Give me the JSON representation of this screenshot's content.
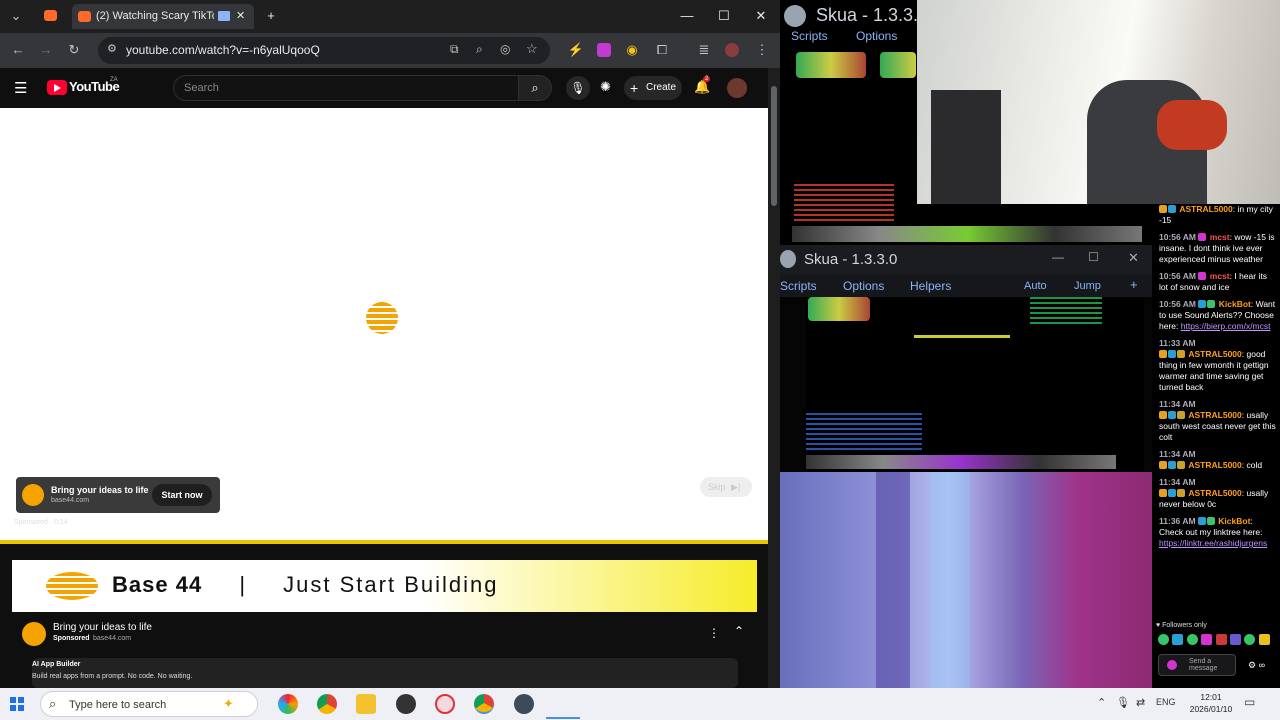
{
  "chrome": {
    "tab_title": "(2) Watching Scary TikToks",
    "url": "youtube.com/watch?v=-n6yalUqooQ",
    "new_tab": "+",
    "win_minimize": "—",
    "win_maximize": "☐",
    "win_close": "✕"
  },
  "youtube": {
    "logo": "YouTube",
    "country": "ZA",
    "search_placeholder": "Search",
    "create_label": "Create",
    "notification_count": "2",
    "ad_title": "Bring your ideas to life",
    "ad_domain": "base44.com",
    "ad_cta": "Start now",
    "sponsored_line": "Sponsored · 0:14",
    "skip_label": "Skip",
    "banner_brand": "Base 44",
    "banner_divider": "|",
    "banner_tagline": "Just Start Building",
    "info_title": "Bring your ideas to life",
    "info_sponsored": "Sponsored",
    "info_domain": "base44.com",
    "app_builder_title": "AI App Builder",
    "app_builder_desc": "Build real apps from a prompt. No code. No waiting."
  },
  "skua_top": {
    "title": "Skua - 1.3.3.",
    "menu": [
      "Scripts",
      "Options"
    ]
  },
  "skua": {
    "title": "Skua - 1.3.3.0",
    "menu": [
      "Scripts",
      "Options",
      "Helpers"
    ],
    "auto_label": "Auto",
    "jump_label": "Jump",
    "plus": "+"
  },
  "chat": {
    "messages": [
      {
        "time": "",
        "user": "ASTRAL5000",
        "text": "in my city -15",
        "color": "orange"
      },
      {
        "time": "10:56 AM",
        "user": "mcst",
        "text": "wow -15 is insane. I dont think ive ever experienced minus weather",
        "color": "red"
      },
      {
        "time": "10:56 AM",
        "user": "mcst",
        "text": "I hear its lot of snow and ice",
        "color": "red"
      },
      {
        "time": "10:56 AM",
        "user": "KickBot",
        "text": "Want to use Sound Alerts?? Choose here:",
        "link": "https://bierp.com/x/mcst",
        "color": "orange"
      },
      {
        "time": "11:33 AM",
        "user": "ASTRAL5000",
        "text": "good thing in few wmonth it gettign warmer and time saving get turned back",
        "color": "orange"
      },
      {
        "time": "11:34 AM",
        "user": "ASTRAL5000",
        "text": "usally south west coast never get this colt",
        "color": "orange"
      },
      {
        "time": "11:34 AM",
        "user": "ASTRAL5000",
        "text": "cold",
        "color": "orange"
      },
      {
        "time": "11:34 AM",
        "user": "ASTRAL5000",
        "text": "usally never below 0c",
        "color": "orange"
      },
      {
        "time": "11:36 AM",
        "user": "KickBot",
        "text": "Check out my linktree here:",
        "link": "https://linktr.ee/rashidjurgens",
        "color": "orange"
      }
    ],
    "followers_only": "Followers only",
    "input_placeholder": "Send a message"
  },
  "taskbar": {
    "search_placeholder": "Type here to search",
    "language": "ENG",
    "time": "12:01",
    "date": "2026/01/10"
  }
}
